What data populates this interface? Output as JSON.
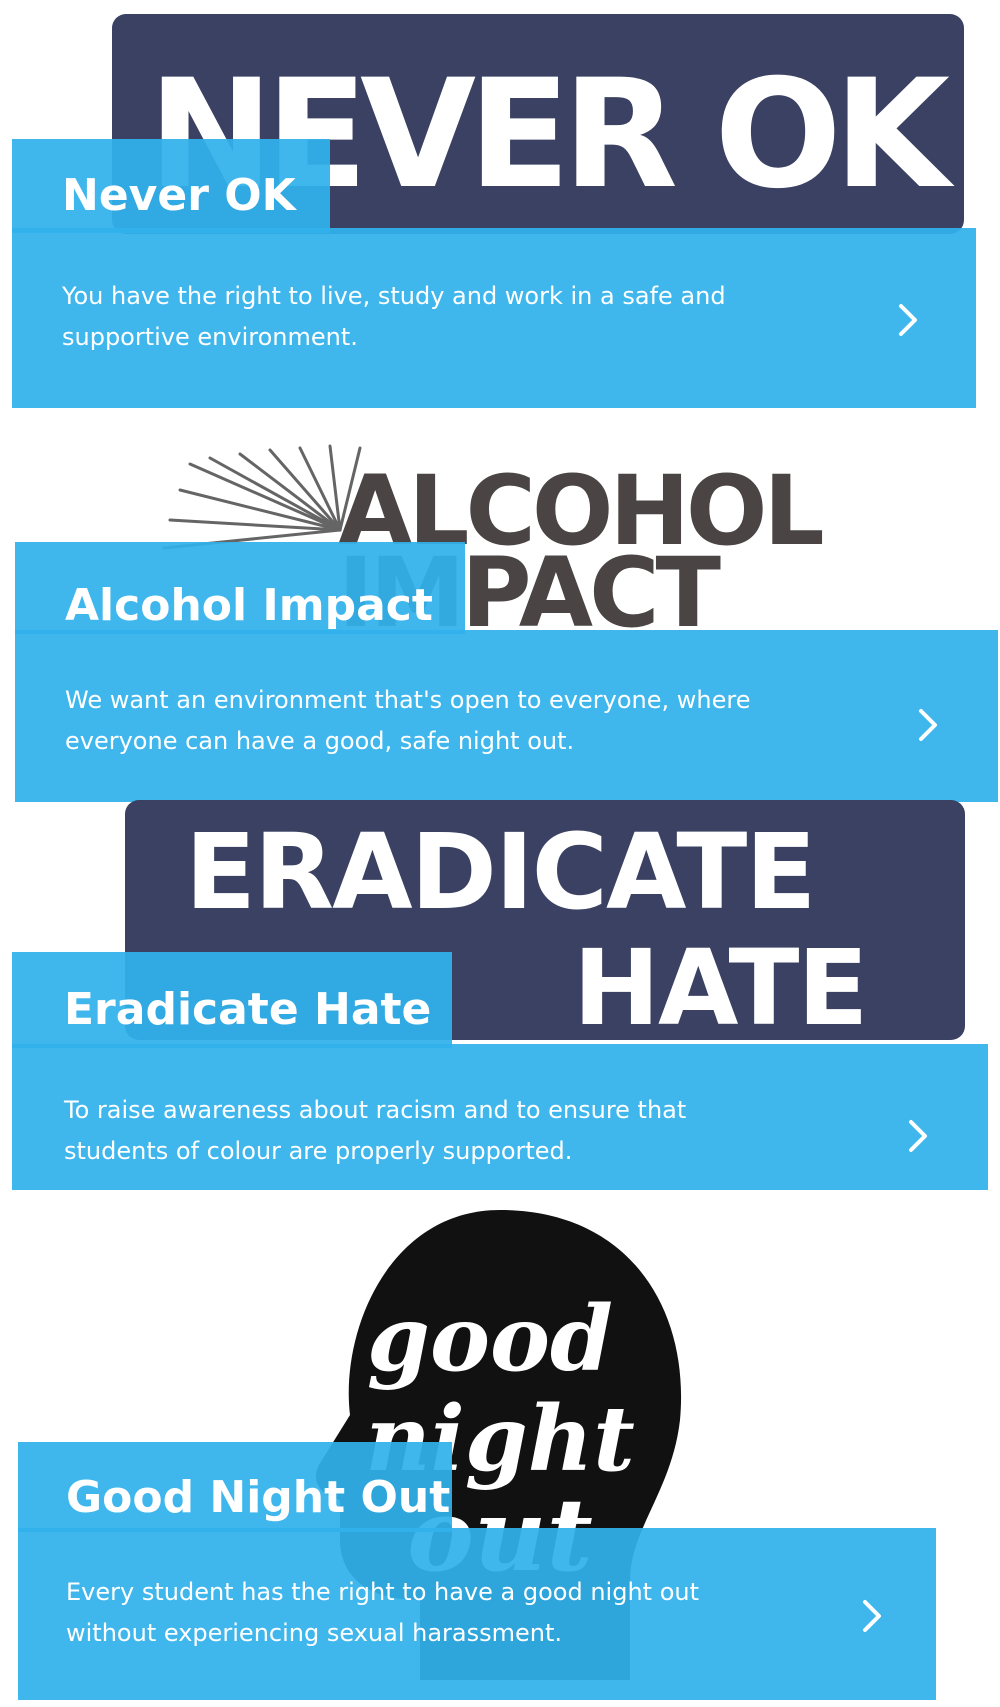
{
  "colors": {
    "panel_blue": "#30b2ec",
    "navy": "#3a4162",
    "dark_gray": "#4a4544",
    "black": "#111111",
    "white": "#ffffff"
  },
  "cards": [
    {
      "logo_text": "NEVER OK",
      "title": "Never OK",
      "description": "You have the right to live, study and work in a safe and supportive environment.",
      "icon": "chevron-right-icon"
    },
    {
      "logo_text_line1": "ALCOHOL",
      "logo_text_line2": "IMPACT",
      "title": "Alcohol Impact",
      "description": "We want an environment that's open to everyone, where everyone can have a good, safe night out.",
      "icon": "chevron-right-icon"
    },
    {
      "logo_text_line1": "ERADICATE",
      "logo_text_line2": "HATE",
      "title": "Eradicate Hate",
      "description": "To raise awareness about racism and to ensure that students of colour are properly supported.",
      "icon": "chevron-right-icon"
    },
    {
      "logo_text_line1": "good",
      "logo_text_line2": "night",
      "logo_text_line3": "out",
      "title": "Good Night Out",
      "description": "Every student has the right to have a good night out without experiencing sexual harassment.",
      "icon": "chevron-right-icon"
    }
  ]
}
